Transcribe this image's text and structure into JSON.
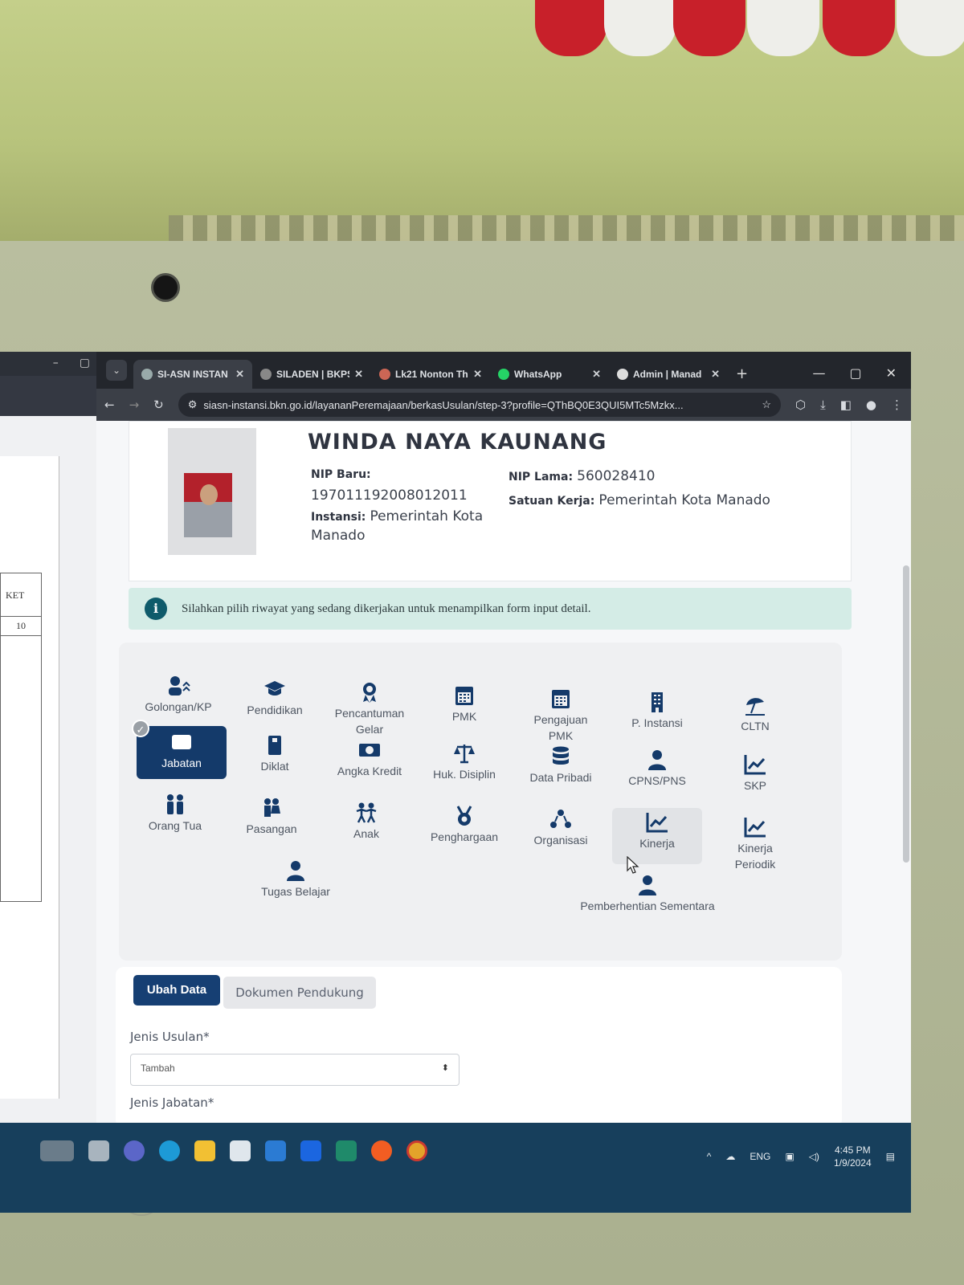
{
  "browser": {
    "tabs": [
      {
        "label": "SI-ASN INSTAN"
      },
      {
        "label": "SILADEN | BKPS"
      },
      {
        "label": "Lk21 Nonton Th"
      },
      {
        "label": "WhatsApp"
      },
      {
        "label": "Admin | Manad"
      }
    ],
    "url": "siasn-instansi.bkn.go.id/layananPeremajaan/berkasUsulan/step-3?profile=QThBQ0E3QUI5MTc5Mzkx..."
  },
  "left_window": {
    "col_header": "KET",
    "cell": "10"
  },
  "profile": {
    "name": "WINDA NAYA KAUNANG",
    "nip_baru_label": "NIP Baru:",
    "nip_baru": "197011192008012011",
    "instansi_label": "Instansi:",
    "instansi_line1": "Pemerintah Kota",
    "instansi_line2": "Manado",
    "nip_lama_label": "NIP Lama:",
    "nip_lama": "560028410",
    "satuan_kerja_label": "Satuan Kerja:",
    "satuan_kerja": "Pemerintah Kota Manado"
  },
  "alert": {
    "text": "Silahkan pilih riwayat yang sedang dikerjakan untuk menampilkan form input detail."
  },
  "menu": {
    "golongan": "Golongan/KP",
    "pendidikan": "Pendidikan",
    "pencantuman_gelar_1": "Pencantuman",
    "pencantuman_gelar_2": "Gelar",
    "pmk": "PMK",
    "pengajuan_pmk_1": "Pengajuan",
    "pengajuan_pmk_2": "PMK",
    "p_instansi": "P. Instansi",
    "cltn": "CLTN",
    "jabatan": "Jabatan",
    "diklat": "Diklat",
    "angka_kredit": "Angka Kredit",
    "huk_disiplin": "Huk. Disiplin",
    "data_pribadi": "Data Pribadi",
    "cpns_pns": "CPNS/PNS",
    "skp": "SKP",
    "orang_tua": "Orang Tua",
    "pasangan": "Pasangan",
    "anak": "Anak",
    "penghargaan": "Penghargaan",
    "organisasi": "Organisasi",
    "kinerja": "Kinerja",
    "kinerja_periodik_1": "Kinerja",
    "kinerja_periodik_2": "Periodik",
    "tugas_belajar": "Tugas Belajar",
    "pemberhentian_sementara": "Pemberhentian Sementara",
    "active_check": "✓"
  },
  "form": {
    "tab_ubah_data": "Ubah Data",
    "tab_dokumen": "Dokumen Pendukung",
    "jenis_usulan_label": "Jenis Usulan*",
    "jenis_usulan_value": "Tambah",
    "jenis_jabatan_label": "Jenis Jabatan*"
  },
  "taskbar": {
    "language": "ENG",
    "time": "4:45 PM",
    "date": "1/9/2024"
  },
  "colors": {
    "primary": "#163f73",
    "icon": "#143a6a",
    "alert_bg": "#d4ece6",
    "taskbar": "#173f5c"
  }
}
